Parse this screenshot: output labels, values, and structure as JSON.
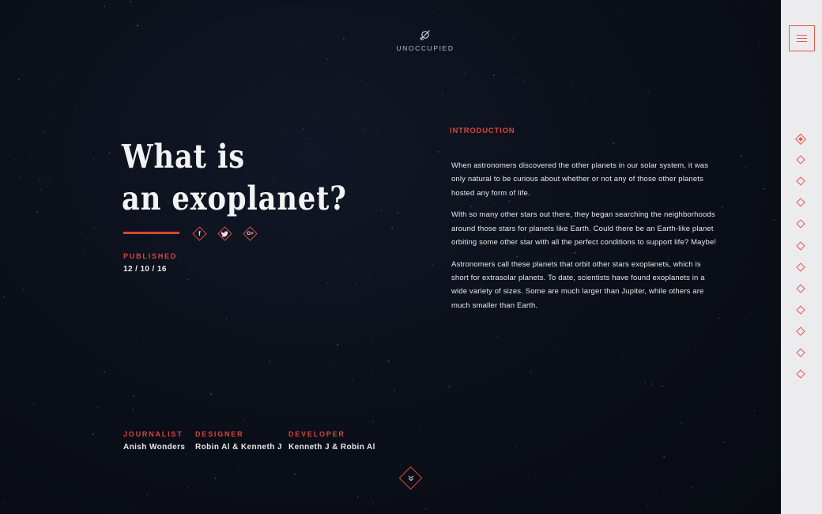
{
  "logo": {
    "text": "UNOCCUPIED",
    "icon": "planet-icon"
  },
  "article": {
    "title_line1": "What is",
    "title_line2": "an exoplanet?",
    "published_label": "PUBLISHED",
    "published_date": "12 / 10 / 16"
  },
  "social": [
    {
      "name": "facebook-icon",
      "glyph": "f"
    },
    {
      "name": "twitter-icon",
      "glyph": "🐦"
    },
    {
      "name": "google-plus-icon",
      "glyph": "G+"
    }
  ],
  "intro": {
    "label": "INTRODUCTION",
    "paragraphs": [
      "When astronomers discovered the other planets in our solar system, it was only natural to be curious about whether or not any of those other planets hosted any form of life.",
      "With so many other stars out there, they began searching the neighborhoods around those stars for planets like Earth. Could there be an Earth-like planet orbiting some other star with all the perfect conditions to support life? Maybe!",
      "Astronomers call these planets that orbit other stars exoplanets, which is short for extrasolar planets. To date, scientists have found exoplanets in a wide variety of sizes. Some are much larger than Jupiter, while others are much smaller than Earth."
    ]
  },
  "credits": [
    {
      "role": "JOURNALIST",
      "name": "Anish Wonders"
    },
    {
      "role": "DESIGNER",
      "name": "Robin Al & Kenneth J"
    },
    {
      "role": "DEVELOPER",
      "name": "Kenneth J & Robin Al"
    }
  ],
  "nav": {
    "menu_icon": "hamburger-menu-icon",
    "section_count": 12,
    "active_index": 0
  },
  "scroll": {
    "icon": "double-chevron-down-icon"
  },
  "colors": {
    "accent": "#d8463c",
    "background": "#0b0f18",
    "rail": "#ececee"
  }
}
